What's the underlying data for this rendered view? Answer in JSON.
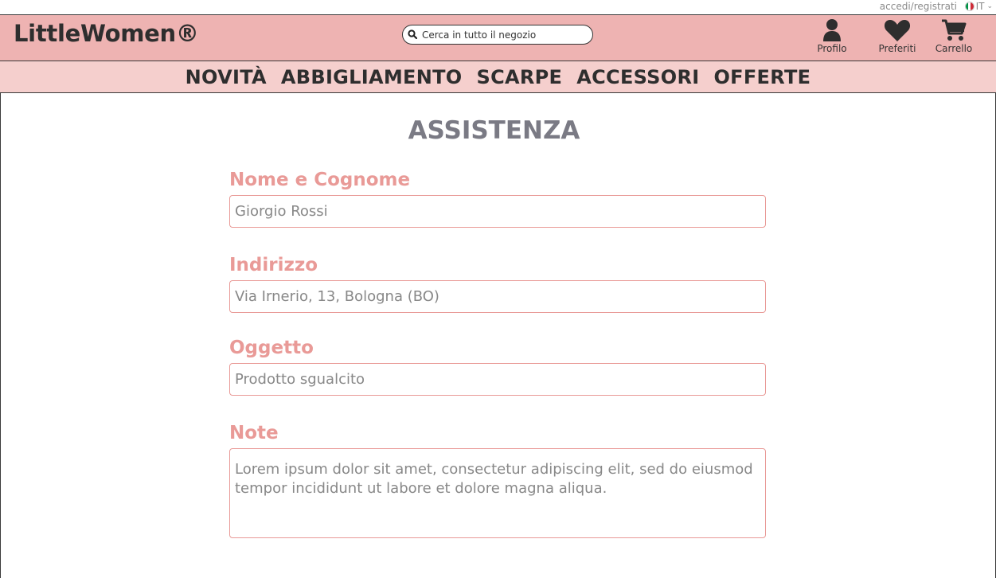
{
  "topbar": {
    "login_label": "accedi/registrati",
    "language": "IT",
    "flag_colors": [
      "#009246",
      "#ffffff",
      "#ce2b37"
    ]
  },
  "header": {
    "logo": "LittleWomen®",
    "search_placeholder": "Cerca in tutto il negozio",
    "icons": [
      {
        "name": "profile-icon",
        "label": "Profilo"
      },
      {
        "name": "heart-icon",
        "label": "Preferiti"
      },
      {
        "name": "cart-icon",
        "label": "Carrello"
      }
    ]
  },
  "nav": {
    "items": [
      "NOVITÀ",
      "ABBIGLIAMENTO",
      "SCARPE",
      "ACCESSORI",
      "OFFERTE"
    ]
  },
  "main": {
    "title": "ASSISTENZA",
    "fields": [
      {
        "label": "Nome e Cognome",
        "value": "Giorgio Rossi"
      },
      {
        "label": "Indirizzo",
        "value": "Via Irnerio, 13, Bologna (BO)"
      },
      {
        "label": "Oggetto",
        "value": "Prodotto sgualcito"
      },
      {
        "label": "Note",
        "value": "Lorem ipsum dolor sit amet, consectetur adipiscing elit, sed do eiusmod tempor incididunt ut labore et dolore magna aliqua."
      }
    ]
  },
  "colors": {
    "header_bg": "#eeb3b2",
    "nav_bg": "#f5cfcd",
    "accent": "#e99a97",
    "title": "#7a7a84"
  }
}
